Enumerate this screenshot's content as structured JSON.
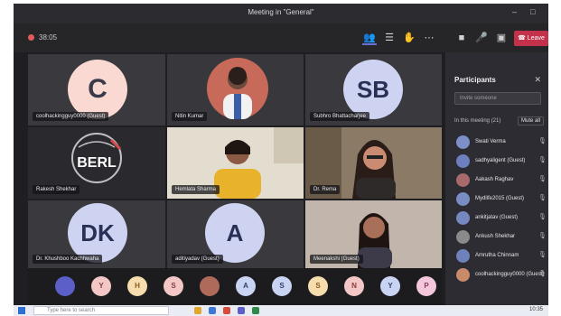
{
  "window": {
    "title": "Meeting in \"General\""
  },
  "toolbar": {
    "timer": "38:05",
    "leave_label": "Leave"
  },
  "tiles": [
    {
      "type": "initials",
      "initials": "C",
      "name": "coolhackingguy0000 (Guest)"
    },
    {
      "type": "photo",
      "name": "Nitin Kumar"
    },
    {
      "type": "initials",
      "initials": "SB",
      "name": "Subhro Bhattacharjee"
    },
    {
      "type": "logo",
      "logo_text": "BERL",
      "name": "Rakesh Shekhar"
    },
    {
      "type": "video",
      "name": "Hemlata Sharma"
    },
    {
      "type": "video",
      "name": "Dr. Rema"
    },
    {
      "type": "initials",
      "initials": "DK",
      "name": "Dr. Khushboo Kachhwaha"
    },
    {
      "type": "initials",
      "initials": "A",
      "name": "aditiyadav (Guest)"
    },
    {
      "type": "video",
      "name": "Meenakshi (Guest)"
    }
  ],
  "participants_panel": {
    "title": "Participants",
    "invite_placeholder": "Invite someone",
    "section_label": "In this meeting (21)",
    "mute_all": "Mute all",
    "people": [
      {
        "name": "Swati Verma",
        "color": "#7d8fc9"
      },
      {
        "name": "sadhyaligent (Guest)",
        "color": "#6d7fbf"
      },
      {
        "name": "Aakash Raghav",
        "color": "#a86a6a"
      },
      {
        "name": "Mydlife2015 (Guest)",
        "color": "#7a8cc4"
      },
      {
        "name": "ankitjatav (Guest)",
        "color": "#7688c0"
      },
      {
        "name": "Ankush Shekhar",
        "color": "#8a8a8a"
      },
      {
        "name": "Amrutha Chinnam",
        "color": "#6f81bb"
      },
      {
        "name": "coolhackingguy0000 (Guest)",
        "color": "#c98a6a"
      }
    ]
  },
  "bottom_avatars": [
    {
      "initials": "",
      "color": "#5b5fc7",
      "text_color": "#ffffff"
    },
    {
      "initials": "Y",
      "color": "#f4c7c7",
      "text_color": "#8a3a3a"
    },
    {
      "initials": "H",
      "color": "#f7dcae",
      "text_color": "#8a5a1a"
    },
    {
      "initials": "S",
      "color": "#f4c7c7",
      "text_color": "#8a3a3a"
    },
    {
      "initials": "",
      "color": "#b06a5a",
      "text_color": "#ffffff"
    },
    {
      "initials": "A",
      "color": "#c9d4f2",
      "text_color": "#33406a"
    },
    {
      "initials": "S",
      "color": "#c9d4f2",
      "text_color": "#33406a"
    },
    {
      "initials": "S",
      "color": "#f7dcae",
      "text_color": "#8a5a1a"
    },
    {
      "initials": "N",
      "color": "#f4c7c7",
      "text_color": "#8a3a3a"
    },
    {
      "initials": "Y",
      "color": "#c9d4f2",
      "text_color": "#33406a"
    },
    {
      "initials": "P",
      "color": "#f4c7dc",
      "text_color": "#8a3a5a"
    }
  ],
  "taskbar": {
    "search_placeholder": "Type here to search",
    "time": "10:35"
  },
  "colors": {
    "accent": "#5b5fc7",
    "leave": "#c4314b",
    "avatar_peach": "#fbd9d3",
    "avatar_lilac": "#cdd3f0"
  }
}
